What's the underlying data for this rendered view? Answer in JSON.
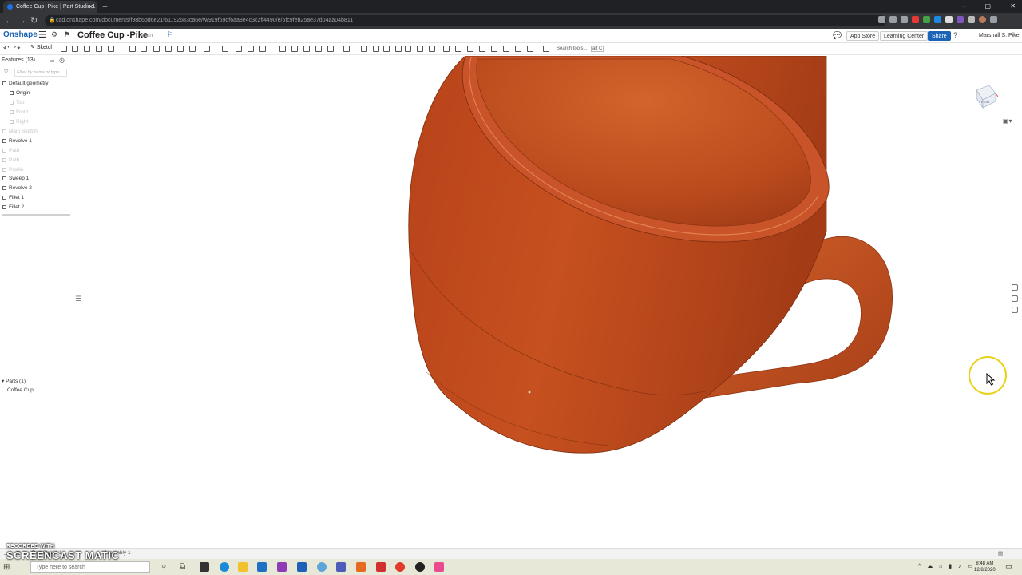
{
  "browser": {
    "tab_title": "Coffee Cup -Pike | Part Studio 1",
    "new_tab": "+",
    "url": "cad.onshape.com/documents/f98b6bd6e21f61192683ca6e/w/919f69df6aa8e4c3c2ff4490/e/5fc9feb25ae37d04aa04b811",
    "window_controls": [
      "–",
      "▢",
      "✕"
    ]
  },
  "onshape": {
    "logo": "Onshape",
    "doc_title": "Coffee Cup -Pike",
    "branch": "Main",
    "app_store": "App Store",
    "learning_center": "Learning Center",
    "share": "Share",
    "user": "Marshall S. Pike",
    "sketch_button": "Sketch",
    "search_tools": "Search tools...",
    "search_shortcut": "alt C"
  },
  "features": {
    "header": "Features (13)",
    "filter_placeholder": "Filter by name or type",
    "items": [
      {
        "label": "Default geometry",
        "dim": false
      },
      {
        "label": "Origin",
        "dim": false
      },
      {
        "label": "Top",
        "dim": true
      },
      {
        "label": "Front",
        "dim": true
      },
      {
        "label": "Right",
        "dim": true
      },
      {
        "label": "Main Sketch",
        "dim": true
      },
      {
        "label": "Revolve 1",
        "dim": false
      },
      {
        "label": "Path",
        "dim": true
      },
      {
        "label": "Path",
        "dim": true
      },
      {
        "label": "Profile",
        "dim": true
      },
      {
        "label": "Sweep 1",
        "dim": false
      },
      {
        "label": "Revolve 2",
        "dim": false
      },
      {
        "label": "Fillet 1",
        "dim": false
      },
      {
        "label": "Fillet 2",
        "dim": false
      }
    ]
  },
  "parts": {
    "header": "Parts (1)",
    "items": [
      "Coffee Cup"
    ]
  },
  "viewcube": {
    "label": "Front"
  },
  "bottom_tabs": [
    "Part Studio 1",
    "Assembly 1"
  ],
  "taskbar": {
    "search_placeholder": "Type here to search",
    "time": "8:48 AM",
    "date": "12/8/2020"
  },
  "watermark": {
    "line1": "RECORDED WITH",
    "line2": "SCREENCAST  MATIC"
  },
  "colors": {
    "cup": "#c24a1e",
    "accent": "#1a63b5",
    "cursor_ring": "#e8d21c"
  }
}
